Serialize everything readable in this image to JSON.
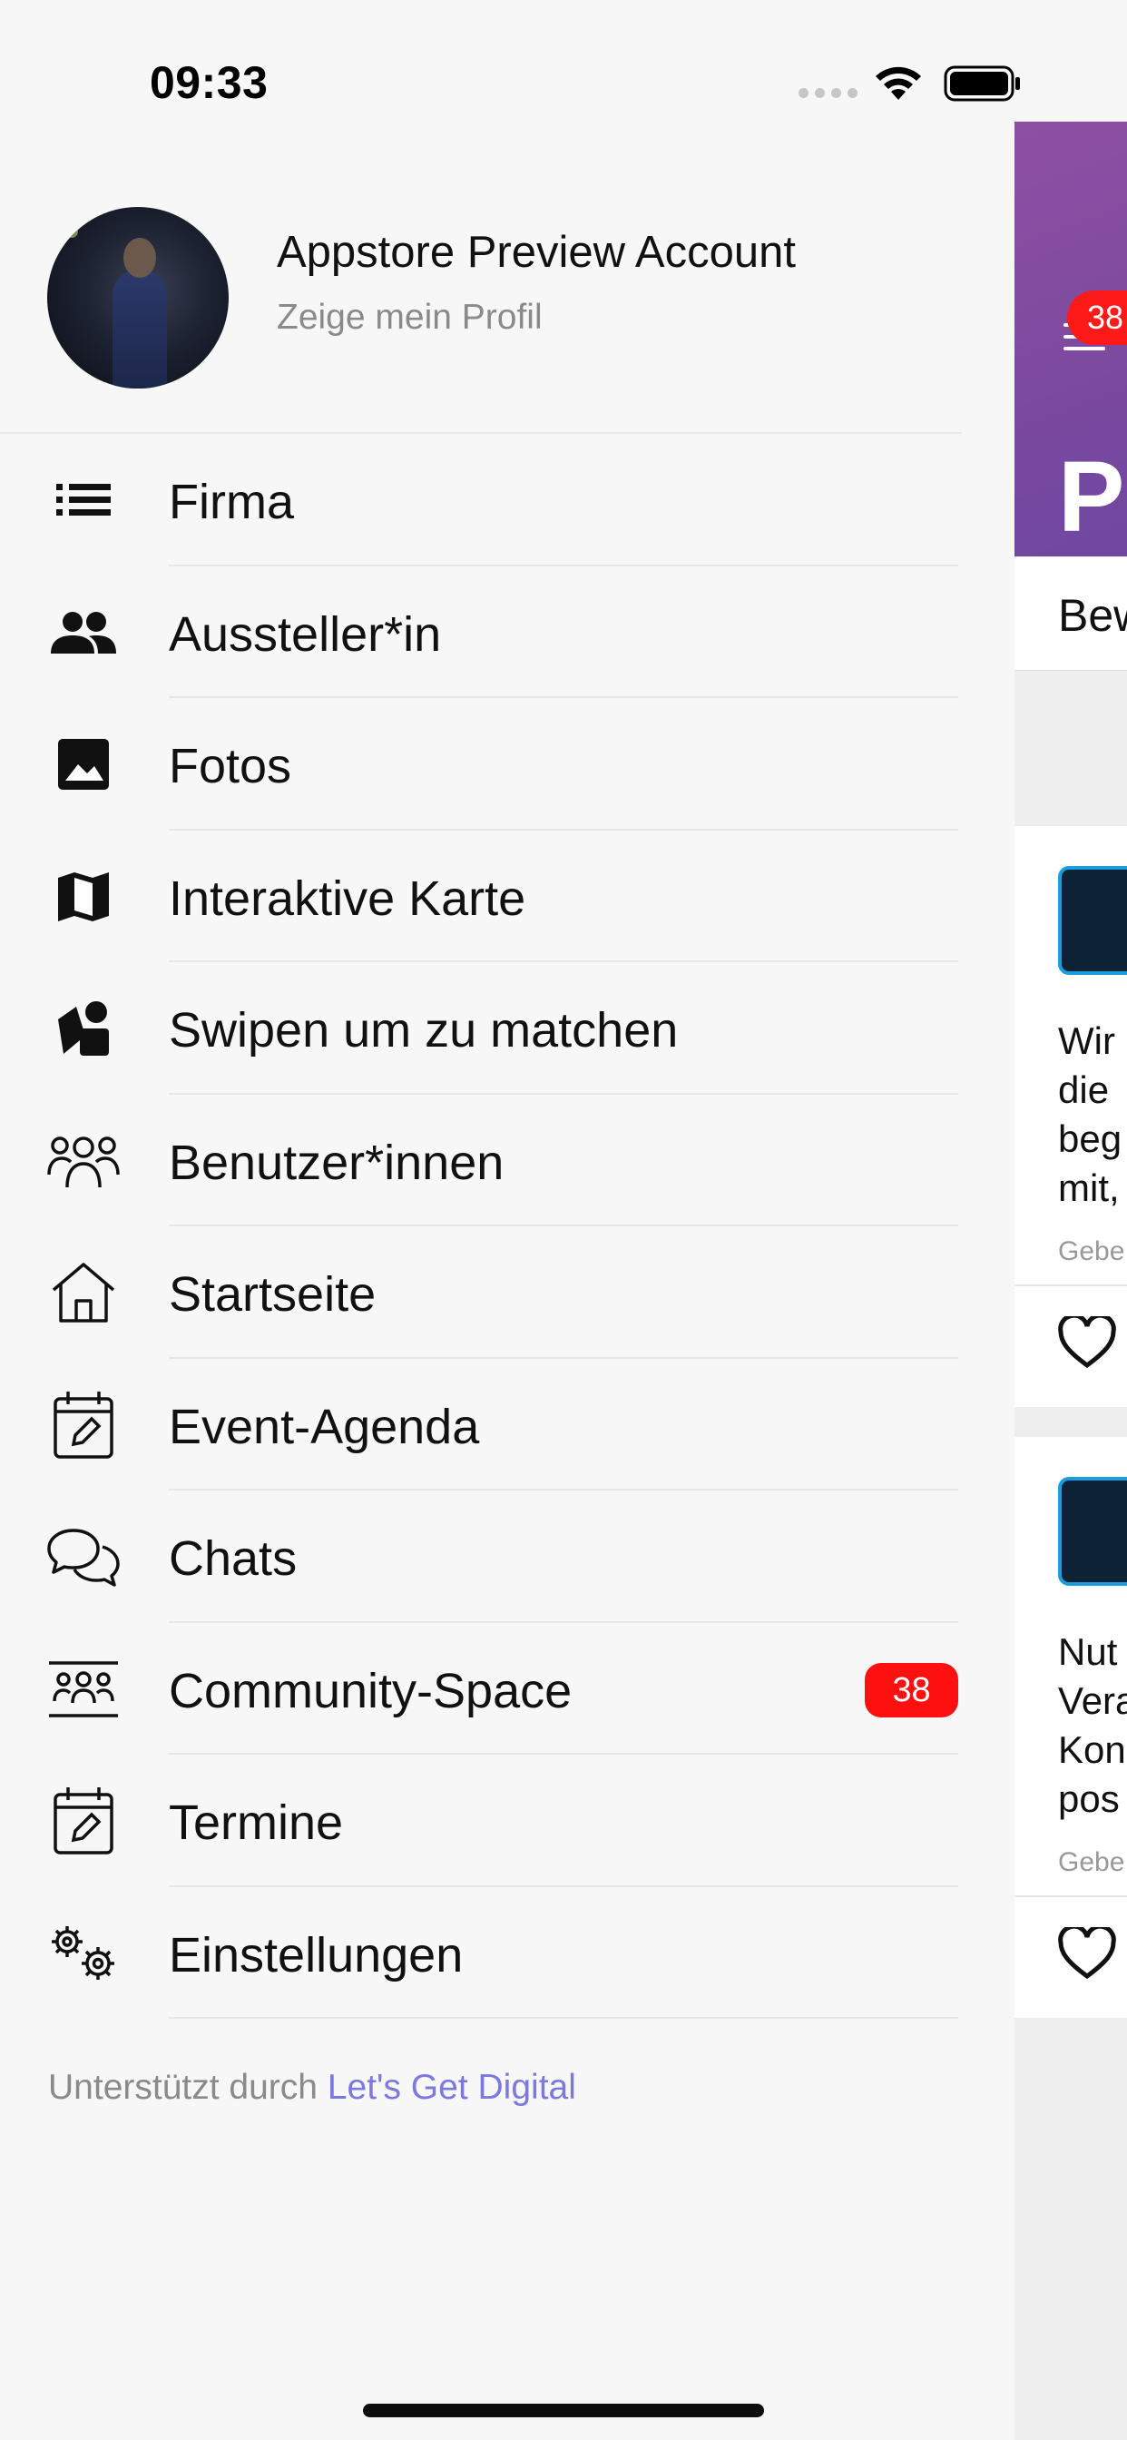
{
  "status_bar": {
    "time": "09:33",
    "icons": [
      "signal-dots-icon",
      "wifi-icon",
      "battery-icon"
    ]
  },
  "profile": {
    "name": "Appstore Preview Account",
    "subtitle": "Zeige mein Profil"
  },
  "menu": {
    "items": [
      {
        "label": "Firma",
        "icon": "list-icon"
      },
      {
        "label": "Aussteller*in",
        "icon": "people-icon"
      },
      {
        "label": "Fotos",
        "icon": "image-icon"
      },
      {
        "label": "Interaktive Karte",
        "icon": "map-icon"
      },
      {
        "label": "Swipen um zu matchen",
        "icon": "shapes-icon"
      },
      {
        "label": "Benutzer*innen",
        "icon": "users-group-icon"
      },
      {
        "label": "Startseite",
        "icon": "home-icon"
      },
      {
        "label": "Event-Agenda",
        "icon": "calendar-edit-icon"
      },
      {
        "label": "Chats",
        "icon": "chat-bubbles-icon"
      },
      {
        "label": "Community-Space",
        "icon": "community-icon",
        "badge": "38"
      },
      {
        "label": "Termine",
        "icon": "calendar-edit-icon"
      },
      {
        "label": "Einstellungen",
        "icon": "gears-icon"
      }
    ]
  },
  "footer": {
    "prefix": "Unterstützt durch",
    "link": "Let's Get Digital"
  },
  "main_peek": {
    "badge": "38",
    "title": "Pi",
    "tab": "Bew",
    "cards": [
      {
        "lines": [
          "Wir",
          "die",
          "beg",
          "mit,"
        ],
        "meta": "Gebe"
      },
      {
        "lines": [
          "Nut",
          "Vera",
          "Kon",
          "pos"
        ],
        "meta": "Gebe"
      }
    ]
  },
  "colors": {
    "header_purple": "#8e4fa3",
    "badge_red": "#ff1010",
    "link": "#7b78e0",
    "background": "#f7f7f7"
  }
}
